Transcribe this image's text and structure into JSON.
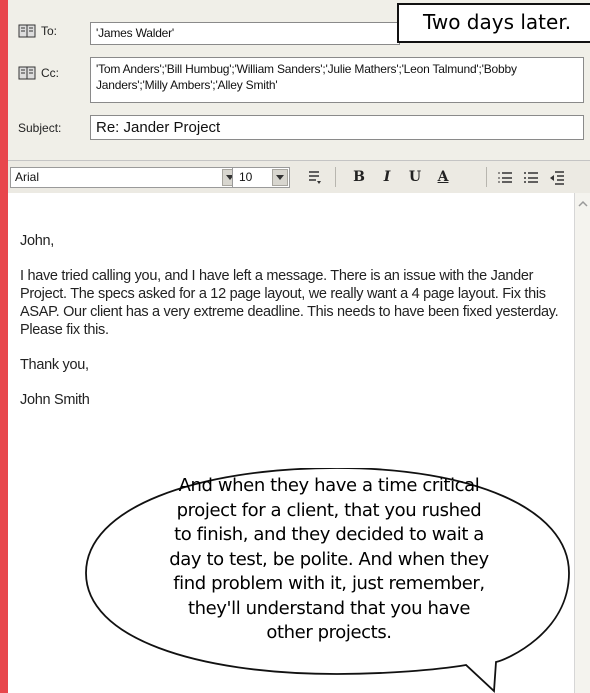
{
  "header": {
    "to_label": "To:",
    "to_value": "'James Walder'",
    "cc_label": "Cc:",
    "cc_value": "'Tom Anders';'Bill Humbug';'William Sanders';'Julie Mathers';'Leon Talmund';'Bobby Janders';'Milly Ambers';'Alley Smith'",
    "subject_label": "Subject:",
    "subject_value": "Re: Jander Project"
  },
  "caption": "Two days later.",
  "toolbar": {
    "font_value": "Arial",
    "size_value": "10",
    "bold": "B",
    "italic": "I",
    "underline": "U",
    "font_color": "A"
  },
  "message": {
    "greeting": "John,",
    "body": "I have tried calling you, and I have left a message.  There is an issue with the Jander Project.  The specs asked for a 12 page layout, we really want a 4 page layout.  Fix this ASAP.  Our client has a very extreme deadline.  This needs to have been fixed yesterday.  Please fix this.",
    "closing": "Thank you,",
    "signature": "John Smith"
  },
  "bubble": {
    "line1": "And when they have a time critical",
    "line2": "project for a client, that you rushed",
    "line3": "to finish, and they decided to wait a",
    "line4": "day to test, be polite.  And when they",
    "line5": "find  problem with it, just remember,",
    "line6": "they'll understand that you have",
    "line7": "other projects."
  },
  "colors": {
    "frame_border": "#e8464c",
    "window_bg": "#f0efe8"
  }
}
